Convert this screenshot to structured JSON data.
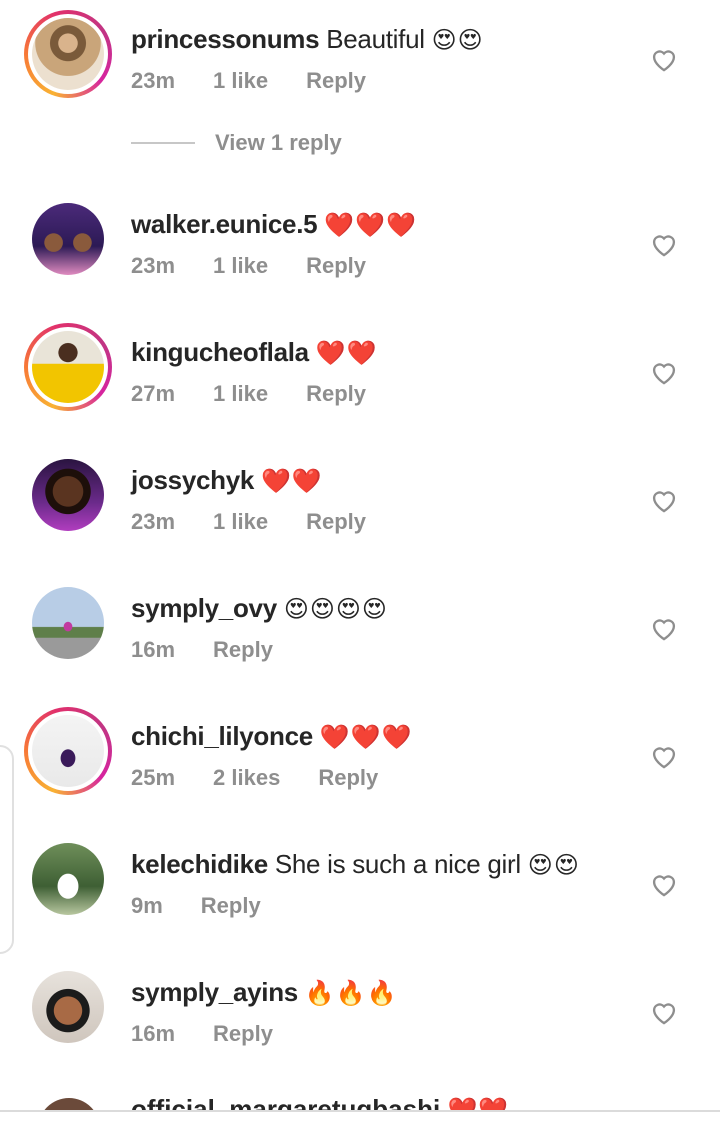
{
  "comments": [
    {
      "username": "princessonums",
      "text": "Beautiful",
      "emoji": "😍😍",
      "time": "23m",
      "likes": "1 like",
      "reply": "Reply",
      "ring": true
    },
    {
      "username": "walker.eunice.5",
      "text": "",
      "emoji": "❤️❤️❤️",
      "time": "23m",
      "likes": "1 like",
      "reply": "Reply",
      "ring": false
    },
    {
      "username": "kingucheoflala",
      "text": "",
      "emoji": "❤️❤️",
      "time": "27m",
      "likes": "1 like",
      "reply": "Reply",
      "ring": true
    },
    {
      "username": "jossychyk",
      "text": "",
      "emoji": "❤️❤️",
      "time": "23m",
      "likes": "1 like",
      "reply": "Reply",
      "ring": false
    },
    {
      "username": "symply_ovy",
      "text": "",
      "emoji": "😍😍😍😍",
      "time": "16m",
      "likes": "",
      "reply": "Reply",
      "ring": false
    },
    {
      "username": "chichi_lilyonce",
      "text": "",
      "emoji": "❤️❤️❤️",
      "time": "25m",
      "likes": "2 likes",
      "reply": "Reply",
      "ring": true
    },
    {
      "username": "kelechidike",
      "text": "She is such a nice girl",
      "emoji": "😍😍",
      "time": "9m",
      "likes": "",
      "reply": "Reply",
      "ring": false
    },
    {
      "username": "symply_ayins",
      "text": "",
      "emoji": "🔥🔥🔥",
      "time": "16m",
      "likes": "",
      "reply": "Reply",
      "ring": false
    }
  ],
  "view_replies": "View 1 reply",
  "partial_comment": {
    "username": "official_margaretugbashi",
    "emoji": "❤️❤️"
  },
  "colors": {
    "text": "#262626",
    "meta": "#8e8e8e",
    "ring_start": "#f9b233",
    "ring_end": "#c13584"
  }
}
